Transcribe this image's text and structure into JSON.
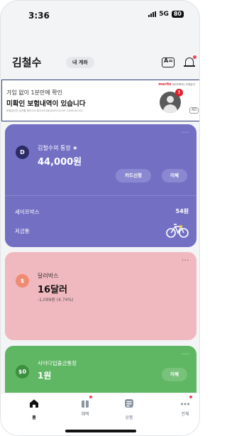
{
  "status_bar": {
    "time": "3:36",
    "network": "5G",
    "battery": "80"
  },
  "header": {
    "user_name": "김철수",
    "my_account_label": "내 계좌"
  },
  "ad": {
    "line1": "가입 없이 1분만에 확인",
    "line2": "미확인 보험내역이 있습니다",
    "line3": "준법감시인 심의필 제2025-광고-451호(2025.04.09~2026.04.22)",
    "brand": "meritz",
    "brand_tail": "메리츠화재 | 보험분석",
    "alert": "!",
    "badge": "AD"
  },
  "accounts": {
    "main": {
      "icon": "D",
      "name": "김철수의 통장 ★",
      "balance": "44,000원",
      "card_button": "카드신청",
      "transfer_button": "이체",
      "safebox_label": "세이프박스",
      "safebox_value": "54원",
      "piggy_label": "저금통"
    },
    "dollar_box": {
      "icon": "$",
      "name": "달러박스",
      "balance": "16달러",
      "sub": "-1,099원 (4.74%)"
    },
    "deposit": {
      "icon": "$0",
      "name": "사이다입출금통장",
      "balance": "1원",
      "transfer_button": "이체"
    }
  },
  "more_label": "···",
  "nav": [
    {
      "label": "홈",
      "icon": "home-icon",
      "active": true
    },
    {
      "label": "혜택",
      "icon": "benefit-icon",
      "active": false
    },
    {
      "label": "상품",
      "icon": "product-icon",
      "active": false
    },
    {
      "label": "전체",
      "icon": "all-icon",
      "active": false
    }
  ],
  "colors": {
    "main_card": "#7370c4",
    "dollar_card": "#f0b8bf",
    "deposit_card": "#5fb663",
    "accent_red": "#f04452"
  }
}
